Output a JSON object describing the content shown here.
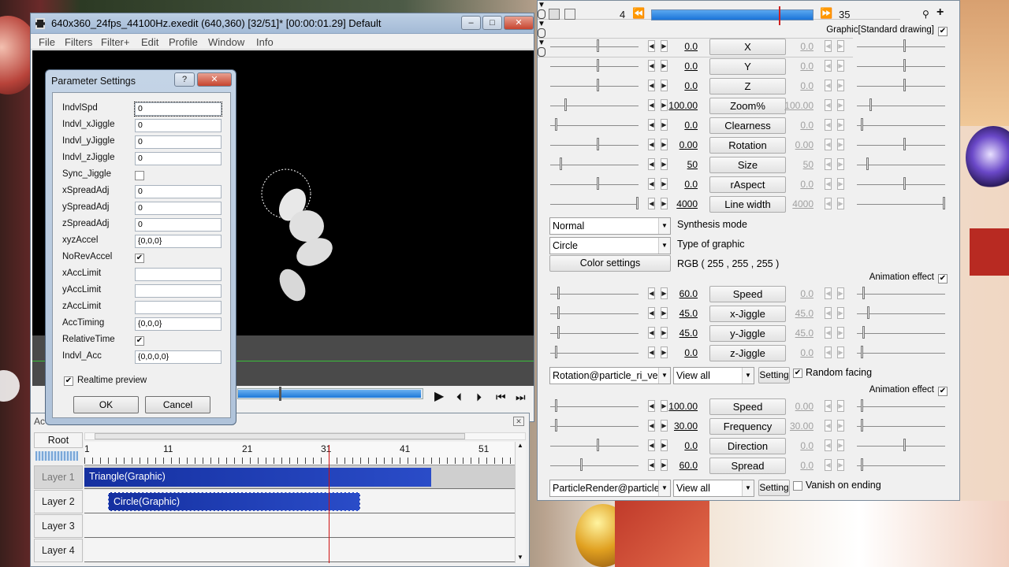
{
  "main_window": {
    "title": "640x360_24fps_44100Hz.exedit (640,360)  [32/51]* [00:00:01.29]  Default",
    "menu": [
      "File",
      "Filters",
      "Filter+",
      "Edit",
      "Profile",
      "Window",
      "Info"
    ],
    "buttons": {
      "minimize": "–",
      "maximize": "□",
      "close": "✕"
    }
  },
  "param_dialog": {
    "title": "Parameter Settings",
    "help": "?",
    "close": "✕",
    "fields": [
      {
        "label": "IndvlSpd",
        "value": "0",
        "type": "text"
      },
      {
        "label": "Indvl_xJiggle",
        "value": "0",
        "type": "text"
      },
      {
        "label": "Indvl_yJiggle",
        "value": "0",
        "type": "text"
      },
      {
        "label": "Indvl_zJiggle",
        "value": "0",
        "type": "text"
      },
      {
        "label": "Sync_Jiggle",
        "value": "",
        "type": "check"
      },
      {
        "label": "xSpreadAdj",
        "value": "0",
        "type": "text"
      },
      {
        "label": "ySpreadAdj",
        "value": "0",
        "type": "text"
      },
      {
        "label": "zSpreadAdj",
        "value": "0",
        "type": "text"
      },
      {
        "label": "xyzAccel",
        "value": "{0,0,0}",
        "type": "text"
      },
      {
        "label": "NoRevAccel",
        "value": "✔",
        "type": "check"
      },
      {
        "label": "xAccLimit",
        "value": "",
        "type": "text"
      },
      {
        "label": "yAccLimit",
        "value": "",
        "type": "text"
      },
      {
        "label": "zAccLimit",
        "value": "",
        "type": "text"
      },
      {
        "label": "AccTiming",
        "value": "{0,0,0}",
        "type": "text"
      },
      {
        "label": "RelativeTime",
        "value": "✔",
        "type": "check"
      },
      {
        "label": "Indvl_Acc",
        "value": "{0,0,0,0}",
        "type": "text"
      }
    ],
    "realtime_label": "Realtime preview",
    "realtime_check": "✔",
    "ok": "OK",
    "cancel": "Cancel"
  },
  "obj_panel": {
    "frame_start": "4",
    "frame_end": "35",
    "seek_progress": 0.79,
    "sec1_title": "Graphic[Standard drawing]",
    "check": "✔",
    "params1": [
      {
        "v1": "0.0",
        "name": "X",
        "v2": "0.0"
      },
      {
        "v1": "0.0",
        "name": "Y",
        "v2": "0.0"
      },
      {
        "v1": "0.0",
        "name": "Z",
        "v2": "0.0"
      },
      {
        "v1": "100.00",
        "name": "Zoom%",
        "v2": "100.00"
      },
      {
        "v1": "0.0",
        "name": "Clearness",
        "v2": "0.0"
      },
      {
        "v1": "0.00",
        "name": "Rotation",
        "v2": "0.00"
      },
      {
        "v1": "50",
        "name": "Size",
        "v2": "50"
      },
      {
        "v1": "0.0",
        "name": "rAspect",
        "v2": "0.0"
      },
      {
        "v1": "4000",
        "name": "Line width",
        "v2": "4000"
      }
    ],
    "synth_value": "Normal",
    "synth_label": "Synthesis mode",
    "type_value": "Circle",
    "type_label": "Type of graphic",
    "color_btn": "Color settings",
    "color_value": "RGB ( 255 , 255 , 255 )",
    "sec2_title": "Animation effect",
    "params2": [
      {
        "v1": "60.0",
        "name": "Speed",
        "v2": "0.0"
      },
      {
        "v1": "45.0",
        "name": "x-Jiggle",
        "v2": "45.0"
      },
      {
        "v1": "45.0",
        "name": "y-Jiggle",
        "v2": "45.0"
      },
      {
        "v1": "0.0",
        "name": "z-Jiggle",
        "v2": "0.0"
      }
    ],
    "sec2_script": "Rotation@particle_ri_ve",
    "sec2_view": "View all",
    "sec2_setting": "Setting",
    "sec2_check_label": "Random facing",
    "sec3_title": "Animation effect",
    "params3": [
      {
        "v1": "100.00",
        "name": "Speed",
        "v2": "0.00"
      },
      {
        "v1": "30.00",
        "name": "Frequency",
        "v2": "30.00"
      },
      {
        "v1": "0.0",
        "name": "Direction",
        "v2": "0.0"
      },
      {
        "v1": "60.0",
        "name": "Spread",
        "v2": "0.0"
      }
    ],
    "sec3_script": "ParticleRender@particle",
    "sec3_view": "View all",
    "sec3_setting": "Setting",
    "sec3_check_label": "Vanish on ending"
  },
  "timeline": {
    "title": "Ac",
    "root": "Root",
    "ticks": [
      "1",
      "11",
      "21",
      "31",
      "41",
      "51"
    ],
    "layers": [
      "Layer 1",
      "Layer 2",
      "Layer 3",
      "Layer 4"
    ],
    "clip1": "Triangle(Graphic)",
    "clip2": "Circle(Graphic)"
  }
}
